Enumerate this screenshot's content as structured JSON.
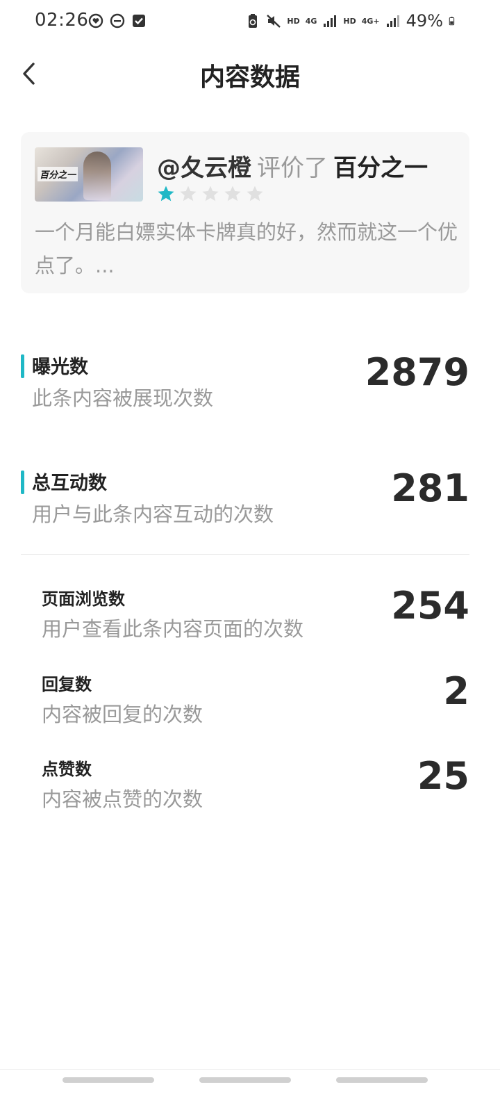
{
  "status_bar": {
    "time": "02:26",
    "battery_text": "49%",
    "network_hd1": "HD",
    "network_4g1": "4G",
    "network_hd2": "HD",
    "network_4g2": "4G+"
  },
  "header": {
    "title": "内容数据",
    "back_icon": "chevron-left-icon"
  },
  "review": {
    "user": "@夂云橙",
    "verb": "评价了",
    "target": "百分之一",
    "rating": 1,
    "rating_max": 5,
    "star_active_color": "#1fb8c6",
    "star_inactive_color": "#e0e0e0",
    "text": "一个月能白嫖实体卡牌真的好，然而就这一个优点了。...",
    "thumb_logo": "百分之一"
  },
  "metrics": {
    "exposure": {
      "label": "曝光数",
      "desc": "此条内容被展现次数",
      "value": "2879"
    },
    "interactions": {
      "label": "总互动数",
      "desc": "用户与此条内容互动的次数",
      "value": "281"
    },
    "page_views": {
      "label": "页面浏览数",
      "desc": "用户查看此条内容页面的次数",
      "value": "254"
    },
    "replies": {
      "label": "回复数",
      "desc": "内容被回复的次数",
      "value": "2"
    },
    "likes": {
      "label": "点赞数",
      "desc": "内容被点赞的次数",
      "value": "25"
    }
  },
  "colors": {
    "accent": "#1fb8c6"
  }
}
